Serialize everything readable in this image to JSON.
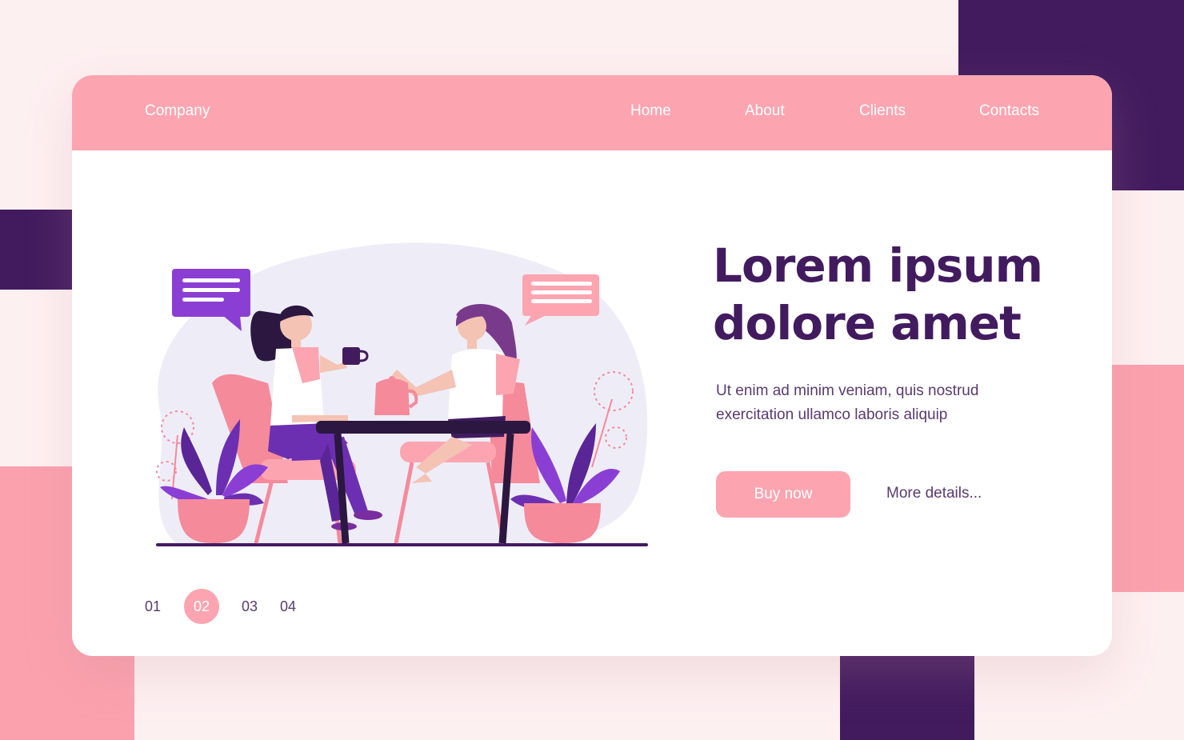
{
  "navbar": {
    "brand": "Company",
    "links": [
      "Home",
      "About",
      "Clients",
      "Contacts"
    ]
  },
  "hero": {
    "headline_line1": "Lorem ipsum",
    "headline_line2": "dolore amet",
    "description_line1": "Ut enim ad minim veniam, quis nostrud",
    "description_line2": "exercitation ullamco laboris aliquip",
    "buy_button": "Buy now",
    "more_link": "More details..."
  },
  "pagination": {
    "pages": [
      "01",
      "02",
      "03",
      "04"
    ],
    "active": "02"
  },
  "colors": {
    "dark_purple": "#421b5f",
    "pink": "#fca5b1",
    "background": "#fdf0f1",
    "lavender": "#eeedf7",
    "violet": "#8b3ed4"
  },
  "illustration": {
    "subject": "two-women-chatting-at-cafe-table",
    "icons": [
      "chat-bubble-icon",
      "coffee-cup-icon",
      "teapot-icon",
      "potted-plant-icon",
      "dandelion-icon"
    ]
  }
}
